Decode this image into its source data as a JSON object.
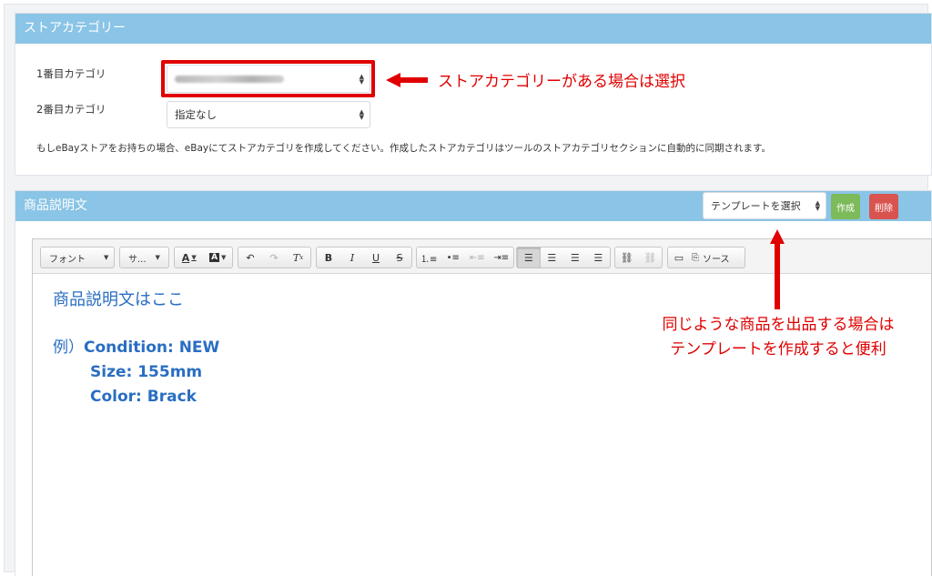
{
  "store_category": {
    "title": "ストアカテゴリー",
    "first_label": "1番目カテゴリ",
    "second_label": "2番目カテゴリ",
    "second_value": "指定なし",
    "note": "もしeBayストアをお持ちの場合、eBayにてストアカテゴリを作成してください。作成したストアカテゴリはツールのストアカテゴリセクションに自動的に同期されます。"
  },
  "description": {
    "title": "商品説明文",
    "template_select": "テンプレートを選択",
    "create_button": "作成",
    "delete_button": "削除"
  },
  "toolbar": {
    "font": "フォント",
    "size": "サ...",
    "source": "ソース"
  },
  "editor_content": {
    "line1": "商品説明文はここ",
    "example_prefix": "例）",
    "condition": "Condition: NEW",
    "size": "Size: 155mm",
    "color": "Color: Brack"
  },
  "annotations": {
    "store_note": "ストアカテゴリーがある場合は選択",
    "template_note_1": "同じような商品を出品する場合は",
    "template_note_2": "テンプレートを作成すると便利"
  },
  "colors": {
    "header_blue": "#8ac4e6",
    "annotation_red": "#e00000",
    "create_green": "#7dba5a",
    "delete_red": "#d9534f",
    "content_blue": "#2a6ec2"
  }
}
